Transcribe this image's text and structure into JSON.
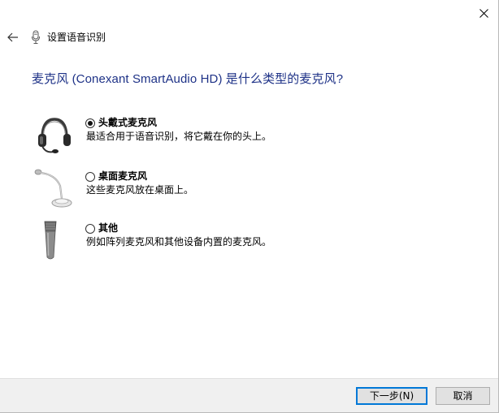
{
  "window": {
    "close_icon": "close-icon"
  },
  "header": {
    "back_icon": "back-arrow-icon",
    "wizard_icon": "microphone-icon",
    "title": "设置语音识别"
  },
  "main": {
    "question": "麦克风 (Conexant SmartAudio HD) 是什么类型的麦克风?",
    "options": [
      {
        "label": "头戴式麦克风",
        "description": "最适合用于语音识别，将它戴在你的头上。",
        "selected": true,
        "icon": "headset-microphone-icon"
      },
      {
        "label": "桌面麦克风",
        "description": "这些麦克风放在桌面上。",
        "selected": false,
        "icon": "desktop-microphone-icon"
      },
      {
        "label": "其他",
        "description": "例如阵列麦克风和其他设备内置的麦克风。",
        "selected": false,
        "icon": "handheld-microphone-icon"
      }
    ]
  },
  "footer": {
    "next_label": "下一步(N)",
    "cancel_label": "取消"
  },
  "colors": {
    "question_text": "#1e3287",
    "footer_bg": "#f0f0f0",
    "default_button_border": "#0078d7"
  }
}
